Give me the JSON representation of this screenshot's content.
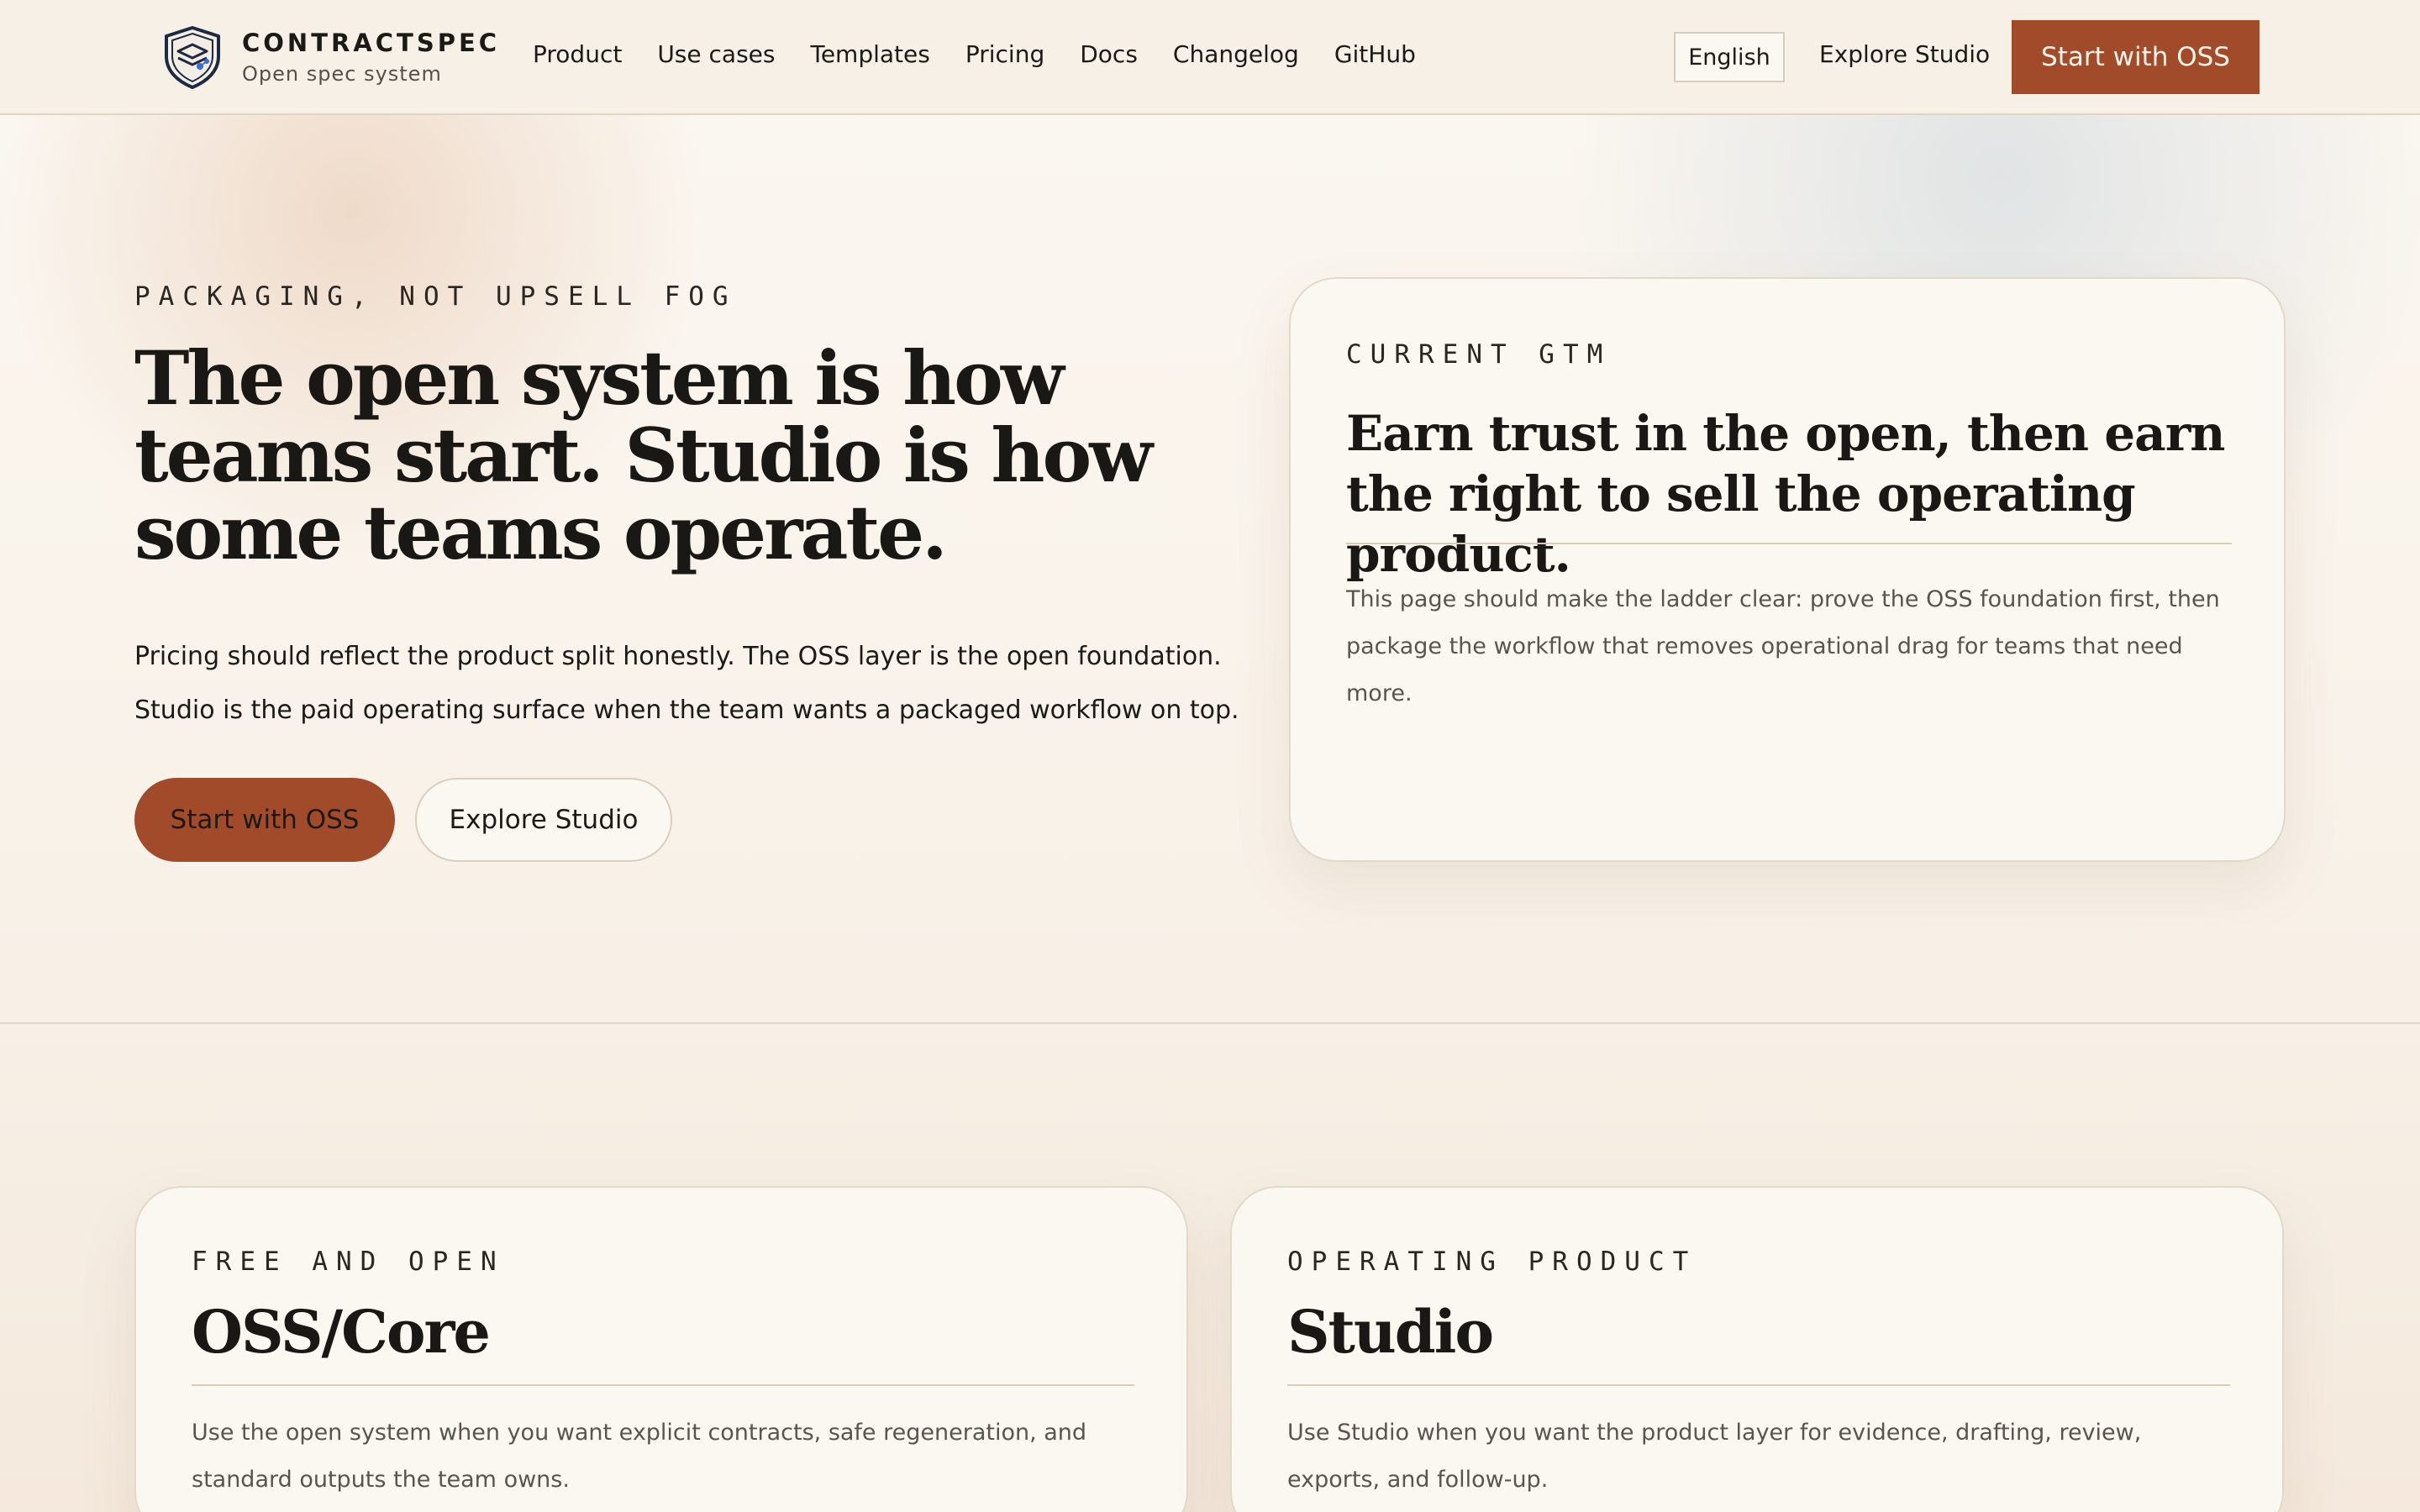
{
  "colors": {
    "accent": "#a24b2b",
    "ink": "#1c1a17",
    "muted": "#5a544c",
    "paper": "#fbf8f2",
    "border": "#e3d9cb"
  },
  "header": {
    "brand_name": "CONTRACTSPEC",
    "brand_tagline": "Open spec system",
    "brand_icon": "shield-logo-icon",
    "nav": [
      "Product",
      "Use cases",
      "Templates",
      "Pricing",
      "Docs",
      "Changelog",
      "GitHub"
    ],
    "language": "English",
    "explore_label": "Explore Studio",
    "cta_label": "Start with OSS"
  },
  "hero": {
    "eyebrow": "PACKAGING, NOT UPSELL FOG",
    "title": "The open system is how teams start. Studio is how some teams operate.",
    "body": "Pricing should reflect the product split honestly. The OSS layer is the open foundation. Studio is the paid operating surface when the team wants a packaged workflow on top.",
    "primary_button": "Start with OSS",
    "secondary_button": "Explore Studio"
  },
  "gtm_card": {
    "eyebrow": "CURRENT GTM",
    "title": "Earn trust in the open, then earn the right to sell the operating product.",
    "body": "This page should make the ladder clear: prove the OSS foundation first, then package the workflow that removes operational drag for teams that need more."
  },
  "tiers": [
    {
      "eyebrow": "FREE AND OPEN",
      "title": "OSS/Core",
      "body": "Use the open system when you want explicit contracts, safe regeneration, and standard outputs the team owns."
    },
    {
      "eyebrow": "OPERATING PRODUCT",
      "title": "Studio",
      "body": "Use Studio when you want the product layer for evidence, drafting, review, exports, and follow-up."
    }
  ]
}
